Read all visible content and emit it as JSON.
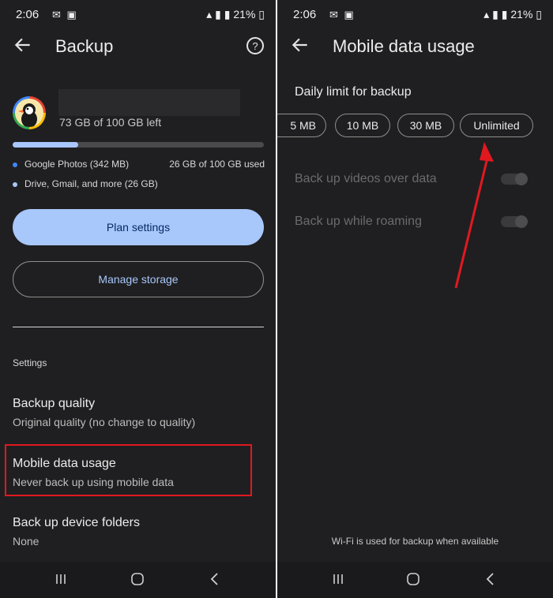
{
  "left": {
    "status": {
      "time": "2:06",
      "battery": "21%"
    },
    "title": "Backup",
    "storage": {
      "left_label": "73 GB of 100 GB left",
      "used_fraction": 0.26
    },
    "legend": [
      {
        "label": "Google Photos (342 MB)",
        "right": "26 GB of 100 GB used",
        "color": "#4285f4"
      },
      {
        "label": "Drive, Gmail, and more (26 GB)",
        "right": "",
        "color": "#a8c7fa"
      }
    ],
    "buttons": {
      "plan": "Plan settings",
      "manage": "Manage storage"
    },
    "section": "Settings",
    "settings": [
      {
        "title": "Backup quality",
        "subtitle": "Original quality (no change to quality)"
      },
      {
        "title": "Mobile data usage",
        "subtitle": "Never back up using mobile data"
      },
      {
        "title": "Back up device folders",
        "subtitle": "None"
      }
    ]
  },
  "right": {
    "status": {
      "time": "2:06",
      "battery": "21%"
    },
    "title": "Mobile data usage",
    "daily_label": "Daily limit for backup",
    "chips": [
      "5 MB",
      "10 MB",
      "30 MB",
      "Unlimited"
    ],
    "toggles": [
      {
        "label": "Back up videos over data",
        "enabled": false
      },
      {
        "label": "Back up while roaming",
        "enabled": false
      }
    ],
    "footnote": "Wi-Fi is used for backup when available"
  },
  "colors": {
    "annotation": "#e0191f",
    "accent": "#a8c7fa"
  }
}
